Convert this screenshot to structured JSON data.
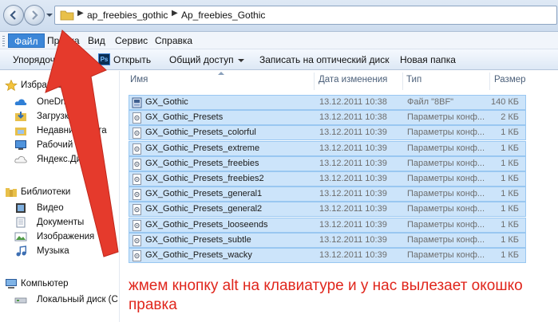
{
  "window": {
    "path": [
      "ap_freebies_gothic",
      "Ap_freebies_Gothic"
    ]
  },
  "menubar": {
    "items": [
      {
        "label": "Файл",
        "active": true
      },
      {
        "label": "Правка",
        "active": false
      },
      {
        "label": "Вид",
        "active": false
      },
      {
        "label": "Сервис",
        "active": false
      },
      {
        "label": "Справка",
        "active": false
      }
    ]
  },
  "commandbar": {
    "organize": "Упорядочить",
    "open": "Открыть",
    "share": "Общий доступ",
    "burn": "Записать на оптический диск",
    "new_folder": "Новая папка"
  },
  "navpane": {
    "favorites_header": "Избранное",
    "favorites": [
      {
        "label": "OneDrive",
        "icon": "cloud-icon"
      },
      {
        "label": "Загрузки",
        "icon": "downloads-icon"
      },
      {
        "label": "Недавние места",
        "icon": "recent-places-icon"
      },
      {
        "label": "Рабочий стол",
        "icon": "desktop-icon"
      },
      {
        "label": "Яндекс.Диск",
        "icon": "yandex-disk-icon"
      }
    ],
    "libraries_header": "Библиотеки",
    "libraries": [
      {
        "label": "Видео",
        "icon": "video-icon"
      },
      {
        "label": "Документы",
        "icon": "documents-icon"
      },
      {
        "label": "Изображения",
        "icon": "images-icon"
      },
      {
        "label": "Музыка",
        "icon": "music-icon"
      }
    ],
    "computer_header": "Компьютер",
    "computer": [
      {
        "label": "Локальный диск (C",
        "icon": "drive-icon"
      }
    ]
  },
  "columns": {
    "name": "Имя",
    "date": "Дата изменения",
    "type": "Тип",
    "size": "Размер"
  },
  "files": [
    {
      "name": "GX_Gothic",
      "date": "13.12.2011 10:38",
      "type": "Файл \"8BF\"",
      "size": "140 КБ",
      "icon": "plugin-file-icon"
    },
    {
      "name": "GX_Gothic_Presets",
      "date": "13.12.2011 10:38",
      "type": "Параметры конф...",
      "size": "2 КБ",
      "icon": "settings-file-icon"
    },
    {
      "name": "GX_Gothic_Presets_colorful",
      "date": "13.12.2011 10:39",
      "type": "Параметры конф...",
      "size": "1 КБ",
      "icon": "settings-file-icon"
    },
    {
      "name": "GX_Gothic_Presets_extreme",
      "date": "13.12.2011 10:39",
      "type": "Параметры конф...",
      "size": "1 КБ",
      "icon": "settings-file-icon"
    },
    {
      "name": "GX_Gothic_Presets_freebies",
      "date": "13.12.2011 10:39",
      "type": "Параметры конф...",
      "size": "1 КБ",
      "icon": "settings-file-icon"
    },
    {
      "name": "GX_Gothic_Presets_freebies2",
      "date": "13.12.2011 10:39",
      "type": "Параметры конф...",
      "size": "1 КБ",
      "icon": "settings-file-icon"
    },
    {
      "name": "GX_Gothic_Presets_general1",
      "date": "13.12.2011 10:39",
      "type": "Параметры конф...",
      "size": "1 КБ",
      "icon": "settings-file-icon"
    },
    {
      "name": "GX_Gothic_Presets_general2",
      "date": "13.12.2011 10:39",
      "type": "Параметры конф...",
      "size": "1 КБ",
      "icon": "settings-file-icon"
    },
    {
      "name": "GX_Gothic_Presets_looseends",
      "date": "13.12.2011 10:39",
      "type": "Параметры конф...",
      "size": "1 КБ",
      "icon": "settings-file-icon"
    },
    {
      "name": "GX_Gothic_Presets_subtle",
      "date": "13.12.2011 10:39",
      "type": "Параметры конф...",
      "size": "1 КБ",
      "icon": "settings-file-icon"
    },
    {
      "name": "GX_Gothic_Presets_wacky",
      "date": "13.12.2011 10:39",
      "type": "Параметры конф...",
      "size": "1 КБ",
      "icon": "settings-file-icon"
    }
  ],
  "annotation": "жмем кнопку alt на клавиатуре и у нас вылезает окошко правка",
  "colors": {
    "selection": "#cce4fa",
    "selection_border": "#99c7f1",
    "annotation": "#e0261c",
    "arrow": "#e53a2c",
    "menu_active": "#3b86d8"
  }
}
